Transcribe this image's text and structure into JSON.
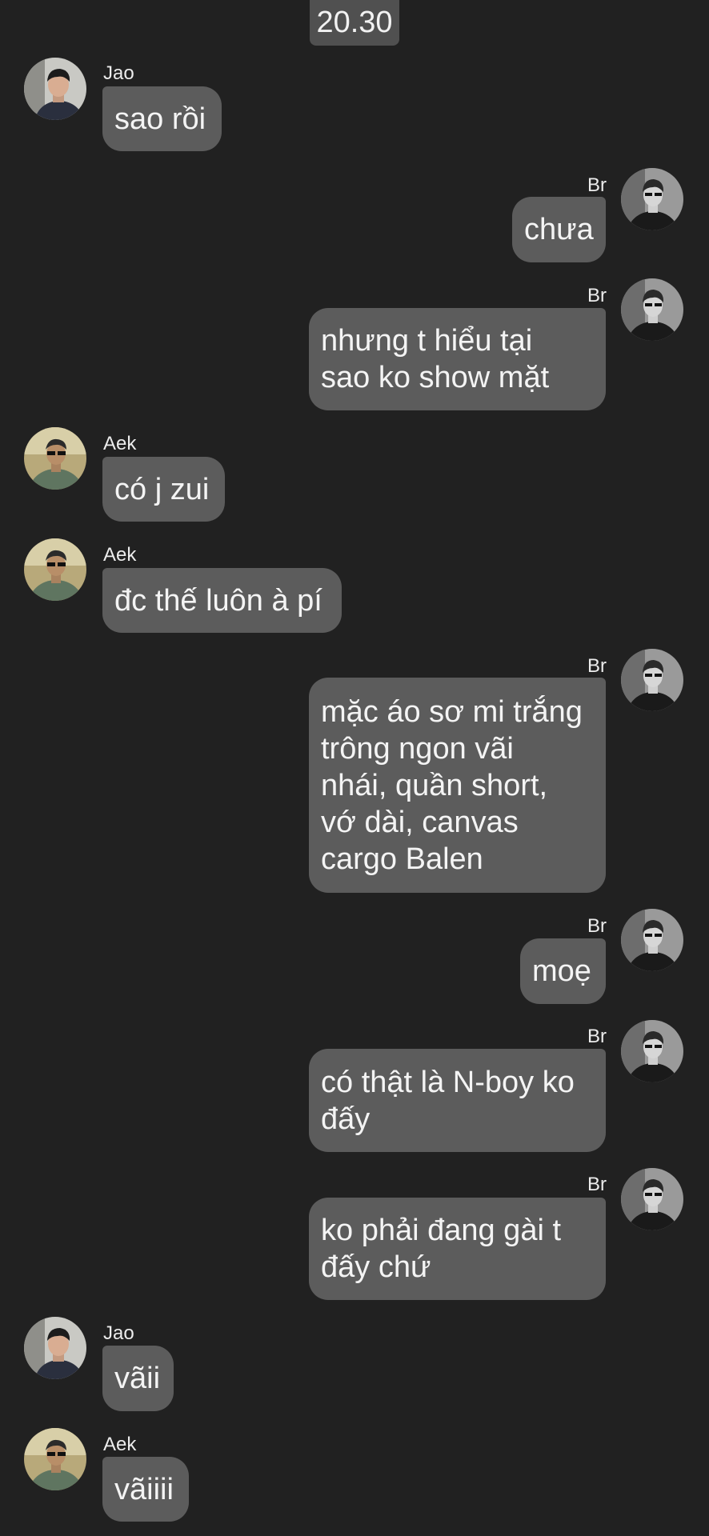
{
  "time": "20.30",
  "messages": [
    {
      "sender": "Jao",
      "side": "left",
      "avatar": "jao-avatar",
      "lines": [
        "sao rồi"
      ]
    },
    {
      "sender": "Br",
      "side": "right",
      "avatar": "br-avatar",
      "lines": [
        "chưa"
      ]
    },
    {
      "sender": "Br",
      "side": "right",
      "avatar": "br-avatar",
      "lines": [
        "nhưng t hiểu tại",
        "sao ko show mặt"
      ]
    },
    {
      "sender": "Aek",
      "side": "left",
      "avatar": "aek-avatar",
      "lines": [
        "có j zui"
      ]
    },
    {
      "sender": "Aek",
      "side": "left",
      "avatar": "aek-avatar",
      "lines": [
        "đc thế luôn à pí"
      ]
    },
    {
      "sender": "Br",
      "side": "right",
      "avatar": "br-avatar",
      "lines": [
        "mặc áo sơ mi trắng",
        "trông ngon vãi",
        "nhái, quần short,",
        "vớ dài, canvas",
        "cargo Balen"
      ]
    },
    {
      "sender": "Br",
      "side": "right",
      "avatar": "br-avatar",
      "lines": [
        "moẹ"
      ]
    },
    {
      "sender": "Br",
      "side": "right",
      "avatar": "br-avatar",
      "lines": [
        "có thật là N-boy ko",
        "đấy"
      ]
    },
    {
      "sender": "Br",
      "side": "right",
      "avatar": "br-avatar",
      "lines": [
        "ko phải đang gài t",
        "đấy chứ"
      ]
    },
    {
      "sender": "Jao",
      "side": "left",
      "avatar": "jao-avatar",
      "lines": [
        "vãii"
      ]
    },
    {
      "sender": "Aek",
      "side": "left",
      "avatar": "aek-avatar",
      "lines": [
        "vãiiii"
      ]
    }
  ]
}
